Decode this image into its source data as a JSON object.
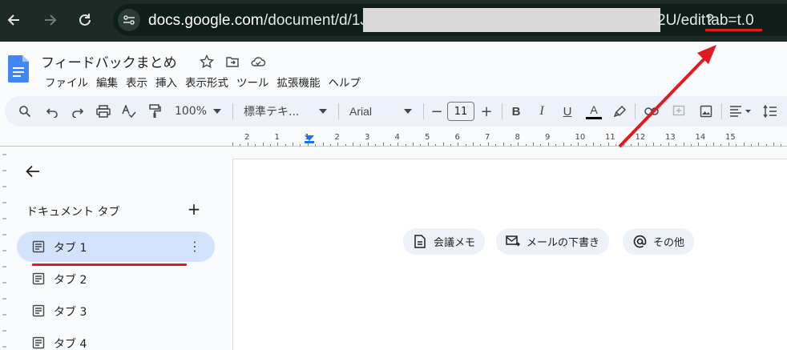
{
  "browser": {
    "url_host": "docs.google.com",
    "url_path_start": "/document/d/1Jm",
    "url_path_end": "2U/edit?",
    "url_query": "tab=t.0",
    "icons": [
      "back-arrow-icon",
      "forward-arrow-icon",
      "reload-icon",
      "site-settings-icon"
    ]
  },
  "doc": {
    "title": "フィードバックまとめ",
    "title_icons": [
      "star-icon",
      "move-to-folder-icon",
      "cloud-status-icon"
    ],
    "menu": [
      "ファイル",
      "編集",
      "表示",
      "挿入",
      "表示形式",
      "ツール",
      "拡張機能",
      "ヘルプ"
    ]
  },
  "toolbar": {
    "zoom": "100%",
    "style": "標準テキ...",
    "font": "Arial",
    "font_size": "11",
    "minus": "−",
    "plus": "+",
    "bold": "B",
    "italic": "I",
    "underline": "U",
    "text_color": "A"
  },
  "ruler": {
    "numbers": [
      "2",
      "1",
      "1",
      "2",
      "3",
      "4",
      "5",
      "6",
      "7",
      "8",
      "9",
      "10",
      "11",
      "12",
      "13",
      "14",
      "15"
    ]
  },
  "side_panel": {
    "heading": "ドキュメント タブ",
    "add": "+",
    "more": "⋮",
    "tabs": [
      {
        "label": "タブ 1",
        "active": true
      },
      {
        "label": "タブ 2",
        "active": false
      },
      {
        "label": "タブ 3",
        "active": false
      },
      {
        "label": "タブ 4",
        "active": false
      }
    ]
  },
  "chips": [
    {
      "label": "会議メモ",
      "icon": "document-icon"
    },
    {
      "label": "メールの下書き",
      "icon": "mail-draft-icon"
    },
    {
      "label": "その他",
      "icon": "at-sign-icon"
    }
  ],
  "colors": {
    "annotation_red": "#e01a22",
    "active_tab": "#d3e3fd",
    "browser_bar": "#1d2b26",
    "docs_blue": "#4285f4"
  }
}
